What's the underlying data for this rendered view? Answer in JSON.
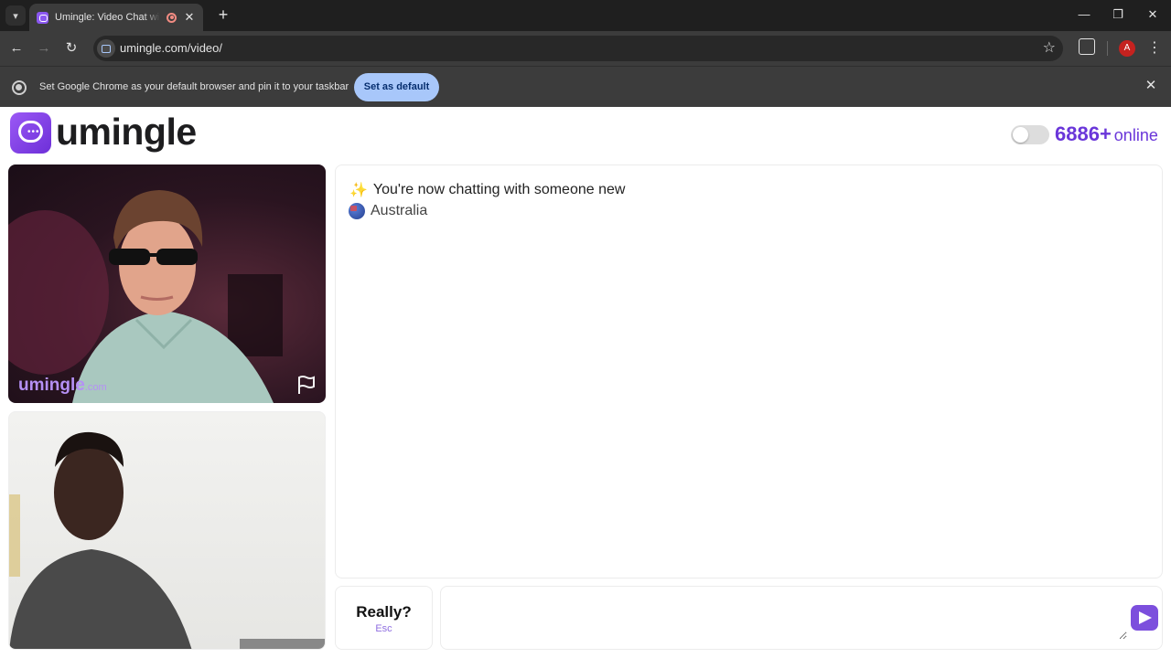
{
  "browser": {
    "tab_title": "Umingle: Video Chat with Strangers",
    "tab_close": "✕",
    "new_tab": "+",
    "url": "umingle.com/video/",
    "infobar_text": "Set Google Chrome as your default browser and pin it to your taskbar",
    "infobar_button": "Set as default",
    "infobar_close": "✕",
    "avatar_initial": "A",
    "window_controls": {
      "minimize": "—",
      "restore": "❐",
      "close": "✕"
    }
  },
  "site": {
    "logo_text": "umingle",
    "online_count": "6886+",
    "online_label": "online",
    "watermark_main": "umingle",
    "watermark_sub": ".com"
  },
  "chat": {
    "status_message": "You're now chatting with someone new",
    "country": "Australia",
    "input_value": ""
  },
  "controls": {
    "skip_label": "Really?",
    "skip_hint": "Esc"
  },
  "colors": {
    "accent": "#7c4fdd",
    "online_text": "#6a36d9",
    "chrome_dark": "#3c3c3c",
    "infobar_button": "#a8c7fa"
  }
}
